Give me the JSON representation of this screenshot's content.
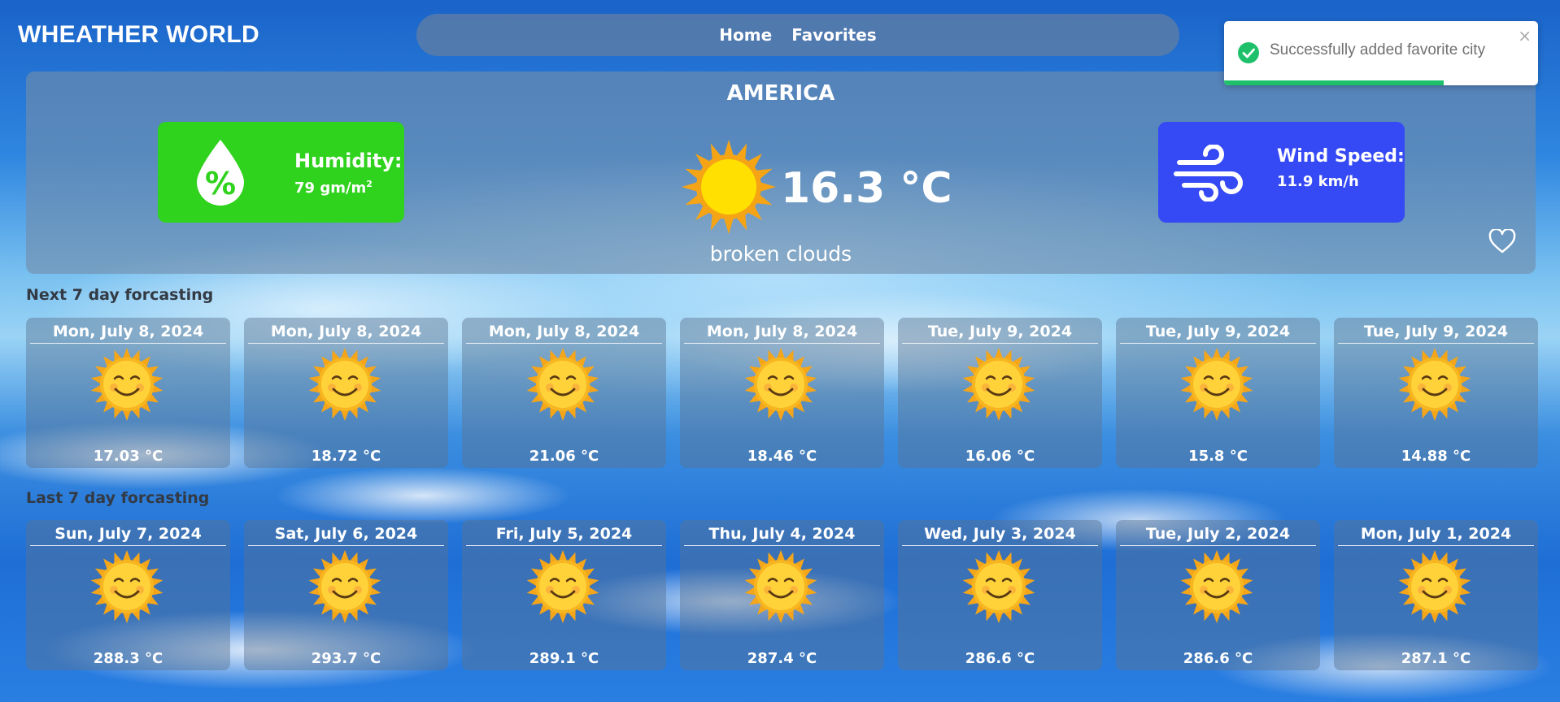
{
  "app": {
    "title": "WHEATHER WORLD"
  },
  "nav": {
    "items": [
      {
        "label": "Home"
      },
      {
        "label": "Favorites"
      }
    ]
  },
  "current": {
    "city": "AMERICA",
    "temperature": "16.3 °C",
    "description": "broken clouds",
    "humidity": {
      "label": "Humidity:",
      "value": "79 gm/m",
      "unit_sup": "2"
    },
    "wind": {
      "label": "Wind Speed:",
      "value": "11.9 km/h"
    }
  },
  "next_section": {
    "title": "Next 7 day forcasting",
    "days": [
      {
        "date": "Mon, July 8, 2024",
        "temp": "17.03 °C"
      },
      {
        "date": "Mon, July 8, 2024",
        "temp": "18.72 °C"
      },
      {
        "date": "Mon, July 8, 2024",
        "temp": "21.06 °C"
      },
      {
        "date": "Mon, July 8, 2024",
        "temp": "18.46 °C"
      },
      {
        "date": "Tue, July 9, 2024",
        "temp": "16.06 °C"
      },
      {
        "date": "Tue, July 9, 2024",
        "temp": "15.8 °C"
      },
      {
        "date": "Tue, July 9, 2024",
        "temp": "14.88 °C"
      }
    ]
  },
  "last_section": {
    "title": "Last 7 day forcasting",
    "days": [
      {
        "date": "Sun, July 7, 2024",
        "temp": "288.3 °C"
      },
      {
        "date": "Sat, July 6, 2024",
        "temp": "293.7 °C"
      },
      {
        "date": "Fri, July 5, 2024",
        "temp": "289.1 °C"
      },
      {
        "date": "Thu, July 4, 2024",
        "temp": "287.4 °C"
      },
      {
        "date": "Wed, July 3, 2024",
        "temp": "286.6 °C"
      },
      {
        "date": "Tue, July 2, 2024",
        "temp": "286.6 °C"
      },
      {
        "date": "Mon, July 1, 2024",
        "temp": "287.1 °C"
      }
    ]
  },
  "toast": {
    "message": "Successfully added favorite city",
    "close": "×",
    "progress": 0.7
  },
  "icons": {
    "humidity": "humidity-drop-icon",
    "wind": "wind-icon",
    "weather": "sun-icon",
    "forecast": "smiling-sun-icon",
    "favorite": "heart-outline-icon",
    "toast": "check-circle-icon"
  },
  "colors": {
    "humidity_card": "#2fd21d",
    "wind_card": "#3549f5",
    "toast_progress": "#1ec16a",
    "toast_check": "#1ec16a"
  }
}
